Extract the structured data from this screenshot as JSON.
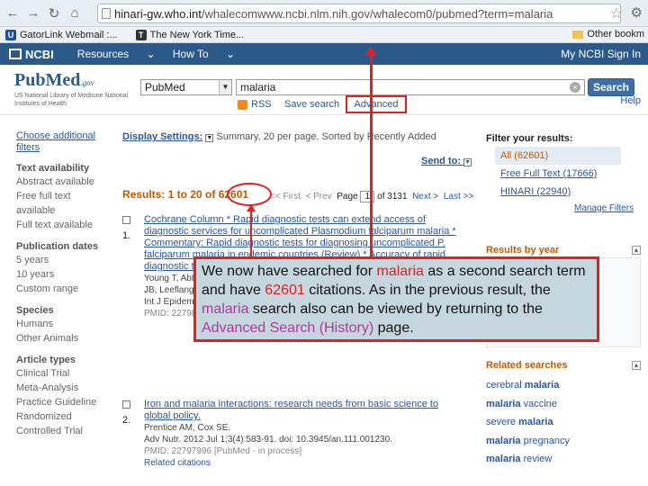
{
  "browser": {
    "url_prefix": "hinari-gw.who.int",
    "url_rest": "/whalecomwww.ncbi.nlm.nih.gov/whalecom0/pubmed?term=malaria",
    "bookmarks": [
      "GatorLink Webmail :...",
      "The New York Time..."
    ],
    "other_bookmarks": "Other bookm",
    "bookmark_colors": [
      "#1e4f9a",
      "#333333"
    ]
  },
  "ncbi": {
    "logo": "NCBI",
    "resources": "Resources",
    "howto": "How To",
    "signin": "My NCBI Sign In"
  },
  "search": {
    "logo": "PubMed",
    "logo_gov": ".gov",
    "subtitle": "US National Library of Medicine National Institutes of Health",
    "db": "PubMed",
    "query": "malaria",
    "button": "Search",
    "rss": "RSS",
    "save": "Save search",
    "advanced": "Advanced",
    "help": "Help"
  },
  "left": {
    "choose": "Choose additional filters",
    "sections": [
      {
        "head": "Text availability",
        "items": [
          "Abstract available",
          "Free full text available",
          "Full text available"
        ]
      },
      {
        "head": "Publication dates",
        "items": [
          "5 years",
          "10 years",
          "Custom range"
        ]
      },
      {
        "head": "Species",
        "items": [
          "Humans",
          "Other Animals"
        ]
      },
      {
        "head": "Article types",
        "items": [
          "Clinical Trial",
          "Meta-Analysis",
          "Practice Guideline",
          "Randomized Controlled Trial"
        ]
      }
    ]
  },
  "main": {
    "display_label": "Display Settings:",
    "display_value": "Summary, 20 per page, Sorted by Recently Added",
    "send_to": "Send to:",
    "results_prefix": "Results: 1 to 20 of",
    "results_count": "62601",
    "pager_first": "<< First",
    "pager_prev": "< Prev",
    "pager_page": "Page",
    "pager_page_value": "1",
    "pager_of": "of 3131",
    "pager_next": "Next >",
    "pager_last": "Last >>",
    "results": [
      {
        "num": "1.",
        "title": "Cochrane Column * Rapid diagnostic tests can extend access of diagnostic services for uncomplicated Plasmodium falciparum malaria * Commentary: Rapid diagnostic tests for diagnosing uncomplicated P. falciparum malaria in endemic countries (Review) * Accuracy of rapid diagnostic tests.",
        "authors": "Young T, Abba K, Takwoingi Y...",
        "extra": "JB, Leeflang MM...",
        "journal": "Int J Epidemiol. 2012 Jun;41(3):607-10. No abstract available",
        "pmid": "PMID: 22798691 [PubMed - in process]",
        "related": ""
      },
      {
        "num": "2.",
        "title": "Iron and malaria interactions: research needs from basic science to global policy.",
        "authors": "Prentice AM, Cox SE.",
        "journal": "Adv Nutr. 2012 Jul 1;3(4):583-91. doi: 10.3945/an.111.001230.",
        "pmid": "PMID: 22797996 [PubMed - in process]",
        "related": "Related citations"
      }
    ]
  },
  "right": {
    "filter_head": "Filter your results:",
    "filters": [
      "All (62601)",
      "Free Full Text (17666)",
      "HINARI (22940)"
    ],
    "manage": "Manage Filters",
    "results_by_year": "Results by year",
    "related_head": "Related searches",
    "related": [
      {
        "pre": "cerebral ",
        "term": "malaria",
        "post": ""
      },
      {
        "pre": "",
        "term": "malaria",
        "post": " vaccine"
      },
      {
        "pre": "severe ",
        "term": "malaria",
        "post": ""
      },
      {
        "pre": "",
        "term": "malaria",
        "post": " pregnancy"
      },
      {
        "pre": "",
        "term": "malaria",
        "post": " review"
      }
    ]
  },
  "callout": {
    "t1": "We now have searched for ",
    "t2": "malaria",
    "t3": " as a second search term and have ",
    "t4": "62601",
    "t5": " citations.  As in the previous result, the ",
    "t6": "malaria",
    "t7": " search also can be viewed by returning to the ",
    "t8": "Advanced Search (History)",
    "t9": " page."
  }
}
